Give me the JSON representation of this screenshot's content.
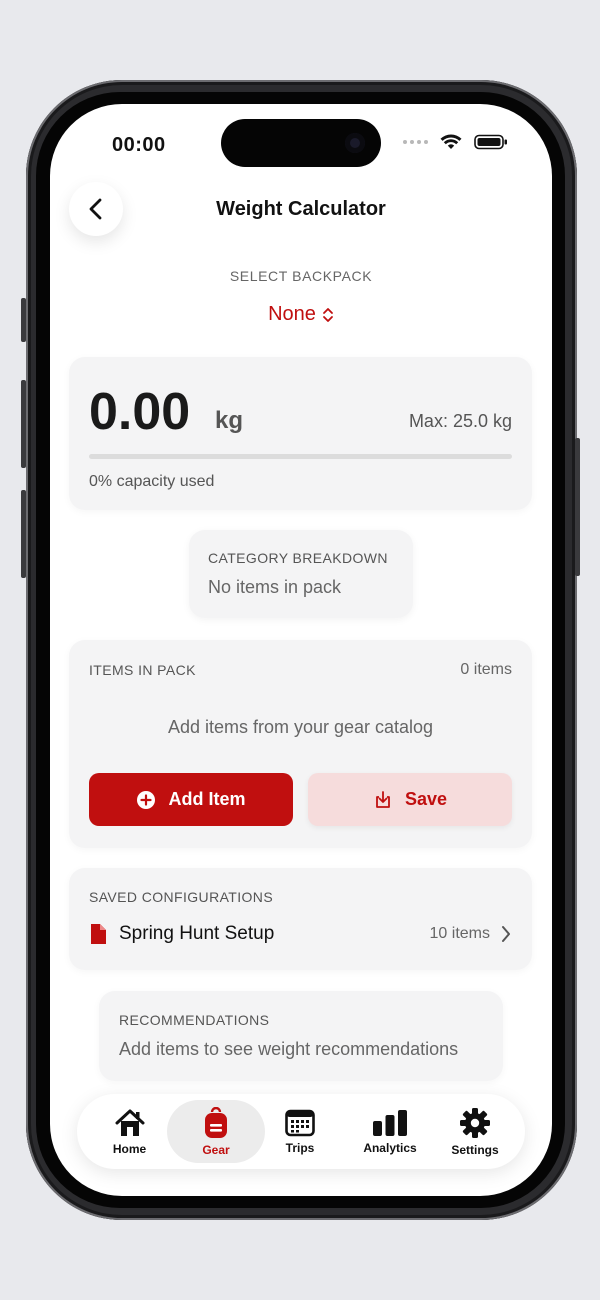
{
  "status_bar": {
    "time": "00:00"
  },
  "header": {
    "title": "Weight Calculator"
  },
  "backpack": {
    "label": "SELECT BACKPACK",
    "value": "None"
  },
  "weight": {
    "value": "0.00",
    "unit": "kg",
    "max": "Max: 25.0 kg",
    "capacity_text": "0% capacity used",
    "capacity_fraction": 0
  },
  "breakdown": {
    "title": "CATEGORY BREAKDOWN",
    "empty": "No items in pack"
  },
  "items": {
    "title": "ITEMS IN PACK",
    "count": "0 items",
    "empty": "Add items from your gear catalog",
    "add_label": "Add Item",
    "save_label": "Save"
  },
  "saved": {
    "title": "SAVED CONFIGURATIONS",
    "configs": [
      {
        "name": "Spring Hunt Setup",
        "count": "10 items"
      }
    ]
  },
  "recommendations": {
    "title": "RECOMMENDATIONS",
    "text": "Add items to see weight recommendations"
  },
  "tabs": [
    {
      "label": "Home",
      "icon": "home-icon"
    },
    {
      "label": "Gear",
      "icon": "backpack-icon",
      "active": true
    },
    {
      "label": "Trips",
      "icon": "calendar-icon"
    },
    {
      "label": "Analytics",
      "icon": "bar-chart-icon"
    },
    {
      "label": "Settings",
      "icon": "gear-icon"
    }
  ],
  "colors": {
    "accent": "#c00f0f",
    "accent_light": "#f6dcdc",
    "card": "#f4f4f5"
  }
}
